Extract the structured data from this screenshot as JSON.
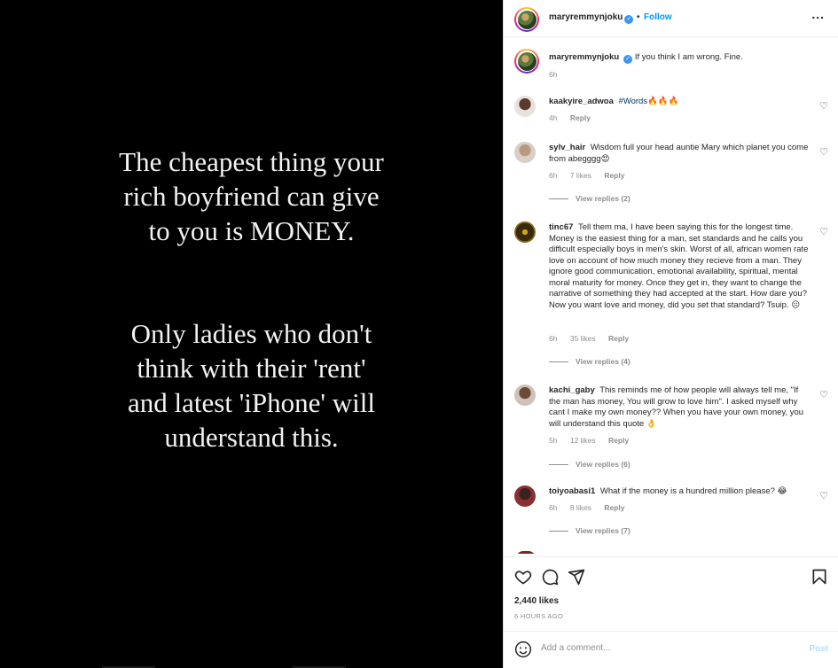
{
  "media": {
    "text_block_1": "The cheapest thing your\nrich boyfriend can give\nto you is MONEY.",
    "text_block_2": "Only ladies who don't\nthink with their 'rent'\nand latest 'iPhone' will\nunderstand this."
  },
  "header": {
    "username": "maryremmynjoku",
    "separator": "•",
    "follow_label": "Follow",
    "more_label": "..."
  },
  "caption": {
    "username": "maryremmynjoku",
    "text": "If you think I am wrong. Fine.",
    "time": "6h"
  },
  "comments": [
    {
      "username": "kaakyire_adwoa",
      "text_before": "",
      "hashtag": "#Words",
      "text": "🔥🔥🔥",
      "time": "4h",
      "likes": "",
      "reply": "Reply",
      "view_replies": ""
    },
    {
      "username": "sylv_hair",
      "text": "Wisdom full your head auntie Mary which planet you come from abegggg😍",
      "time": "6h",
      "likes": "7 likes",
      "reply": "Reply",
      "view_replies": "View replies (2)"
    },
    {
      "username": "tinc67",
      "text": "Tell them ma, I have been saying this for the longest time. Money is the easiest thing for a man, set standards and he calls you difficult especially boys in men's skin. Worst of all, african women rate love on account of how much money they recieve from a man. They ignore good communication, emotional availability, spiritual, mental moral maturity for money. Once they get in, they want to change the narrative of something they had accepted at the start. How dare you? Now you want love and money, did you set that standard? Tsuip. 😐",
      "time": "6h",
      "likes": "35 likes",
      "reply": "Reply",
      "view_replies": "View replies (4)"
    },
    {
      "username": "kachi_gaby",
      "text": "This reminds me of how people will always tell me, \"If the man has money, You will grow to love him\". I asked myself why cant I make my own money?? When you have your own money, you will understand this quote 👌",
      "time": "5h",
      "likes": "12 likes",
      "reply": "Reply",
      "view_replies": "View replies (6)"
    },
    {
      "username": "toiyoabasi1",
      "text": "What if the money is a hundred million please? 😂",
      "time": "6h",
      "likes": "8 likes",
      "reply": "Reply",
      "view_replies": "View replies (7)"
    }
  ],
  "footer": {
    "likes": "2,440 likes",
    "time_ago": "6 HOURS AGO",
    "comment_placeholder": "Add a comment...",
    "post_label": "Post"
  },
  "icons": {
    "heart": "heart-icon",
    "comment": "comment-icon",
    "share": "share-icon",
    "save": "bookmark-icon",
    "emoji": "emoji-icon"
  },
  "colors": {
    "link_blue": "#0095f6",
    "verified_blue": "#3797f0",
    "muted_text": "#8e8e8e",
    "post_disabled": "#b2dffc"
  }
}
